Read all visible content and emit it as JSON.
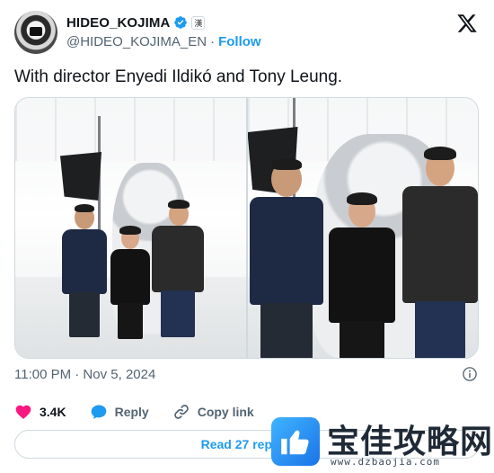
{
  "author": {
    "display_name": "HIDEO_KOJIMA",
    "handle": "@HIDEO_KOJIMA_EN",
    "follow_label": "Follow",
    "affiliation_glyph": "漢",
    "verified_color": "#1d9bf0"
  },
  "tweet": {
    "text": "With director Enyedi Ildikó and Tony Leung.",
    "timestamp": "11:00 PM · Nov 5, 2024"
  },
  "media": {
    "photos": [
      {
        "subject": "three-people-with-robot-wide"
      },
      {
        "subject": "three-people-with-robot-close"
      }
    ]
  },
  "actions": {
    "likes_count": "3.4K",
    "like_color": "#f91880",
    "reply_label": "Reply",
    "copy_link_label": "Copy link",
    "reply_color": "#1d9bf0"
  },
  "read_replies_label": "Read 27 replies",
  "watermark": {
    "title": "宝佳攻略网",
    "url": "www.dzbaojia.com"
  },
  "icons": {
    "x_logo": "x-logo-icon",
    "verified": "verified-badge-icon",
    "info": "info-icon",
    "heart": "heart-icon",
    "reply": "reply-bubble-icon",
    "link": "link-icon"
  }
}
